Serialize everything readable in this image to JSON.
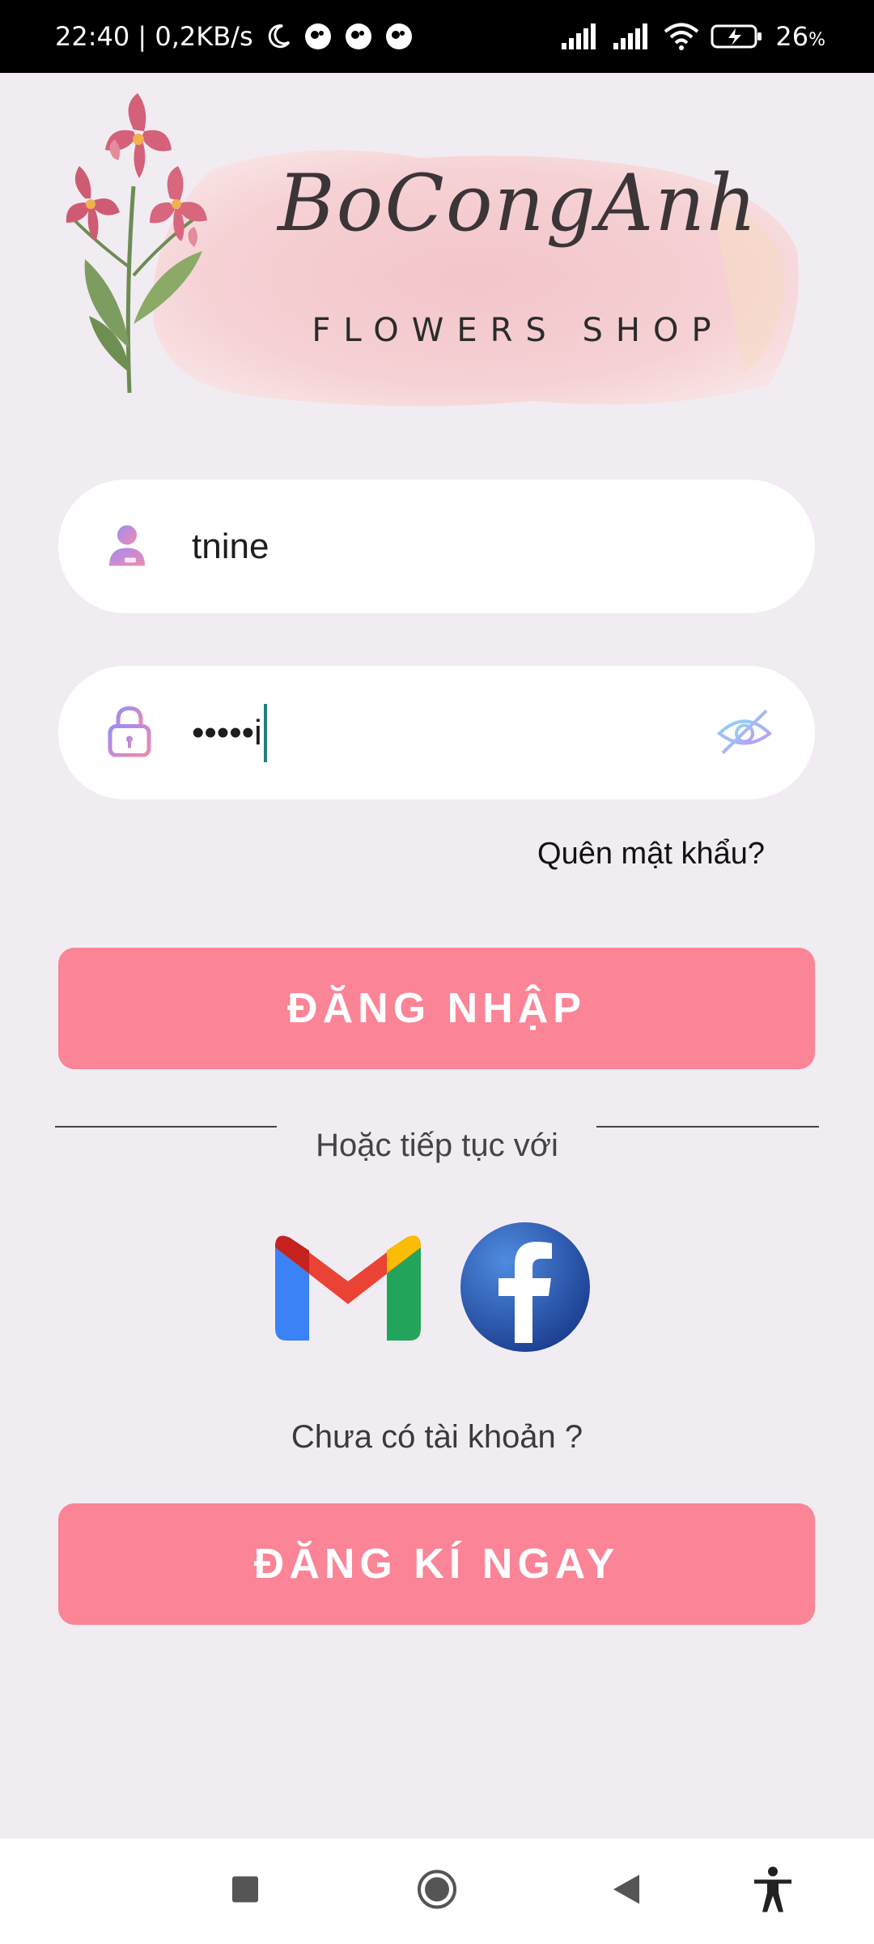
{
  "status_bar": {
    "time_speed": "22:40 | 0,2KB/s",
    "battery": "26",
    "battery_unit": "%",
    "icons": [
      "moon-icon",
      "app-notification-icon",
      "app-notification-icon",
      "app-notification-icon",
      "signal-icon",
      "signal-icon",
      "wifi-icon",
      "battery-charging-icon"
    ]
  },
  "logo": {
    "script_text": "BoCongAnh",
    "subtitle": "FLOWERS SHOP"
  },
  "login_form": {
    "username_value": "tnine",
    "username_icon": "user-icon",
    "password_value": "•••••i",
    "password_icon": "lock-icon",
    "visibility_icon": "eye-off-icon",
    "forgot_password": "Quên mật khẩu?",
    "login_button": "ĐĂNG NHẬP"
  },
  "social": {
    "or_text": "Hoặc tiếp tục với",
    "providers": [
      "gmail-icon",
      "facebook-icon"
    ]
  },
  "signup": {
    "question": "Chưa có tài khoản ?",
    "button": "ĐĂNG KÍ NGAY"
  },
  "colors": {
    "accent": "#fb8497",
    "background": "#f1ecf2",
    "field_bg": "#ffffff",
    "caret": "#1f7f7a"
  },
  "nav_bar": {
    "icons": [
      "recents-icon",
      "home-icon",
      "back-icon",
      "accessibility-icon"
    ]
  }
}
